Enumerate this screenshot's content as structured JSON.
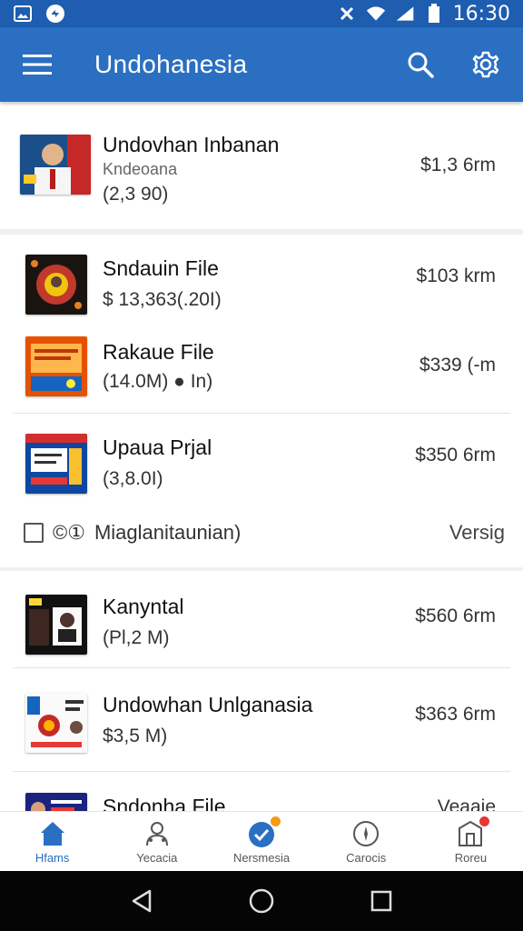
{
  "status_bar": {
    "time": "16:30",
    "left_icons": [
      "gallery-icon",
      "app-notification-icon"
    ],
    "right_icons": [
      "vibrate-icon",
      "wifi-icon",
      "signal-icon",
      "battery-icon"
    ]
  },
  "app_bar": {
    "title": "Undohanesia",
    "menu_icon": "hamburger-menu-icon",
    "search_icon": "search-icon",
    "settings_icon": "gear-icon"
  },
  "items": [
    {
      "title": "Undovhan Inbanan",
      "subtitle_small": "Kndeoana",
      "subtitle": "(2,3 90)",
      "price": "$1,3 6rm"
    },
    {
      "title": "Sndauin File",
      "subtitle": "$ 13,363(.20I)",
      "price": "$103 krm"
    },
    {
      "title": "Rakaue File",
      "subtitle": "(14.0M) ● In)",
      "price": "$339 (-m"
    },
    {
      "title": "Upaua Prjal",
      "subtitle": "(3,8.0I)",
      "price": "$350 6rm"
    },
    {
      "title": "Kanyntal",
      "subtitle": "(Pl,2 M)",
      "price": "$560 6rm"
    },
    {
      "title": "Undowhan Unlganasia",
      "subtitle": "$3,5 M)",
      "price": "$363 6rm"
    },
    {
      "title": "Sndonha File",
      "subtitle": "",
      "price": "Veaaie"
    }
  ],
  "meta_row": {
    "label": "Miaglanitaunian)",
    "prefix_symbol": "©①",
    "link": "Versig"
  },
  "bottom_nav": [
    {
      "label": "Hfams",
      "icon": "home-icon",
      "active": true
    },
    {
      "label": "Yecacia",
      "icon": "person-icon",
      "active": false
    },
    {
      "label": "Nersmesia",
      "icon": "verified-badge-icon",
      "active": false
    },
    {
      "label": "Carocis",
      "icon": "compass-icon",
      "active": false
    },
    {
      "label": "Roreu",
      "icon": "store-icon",
      "active": false
    }
  ],
  "colors": {
    "primary": "#2a6fc2",
    "status_bar": "#1e5db0",
    "badge_orange": "#f39c12",
    "badge_red": "#e53935"
  }
}
